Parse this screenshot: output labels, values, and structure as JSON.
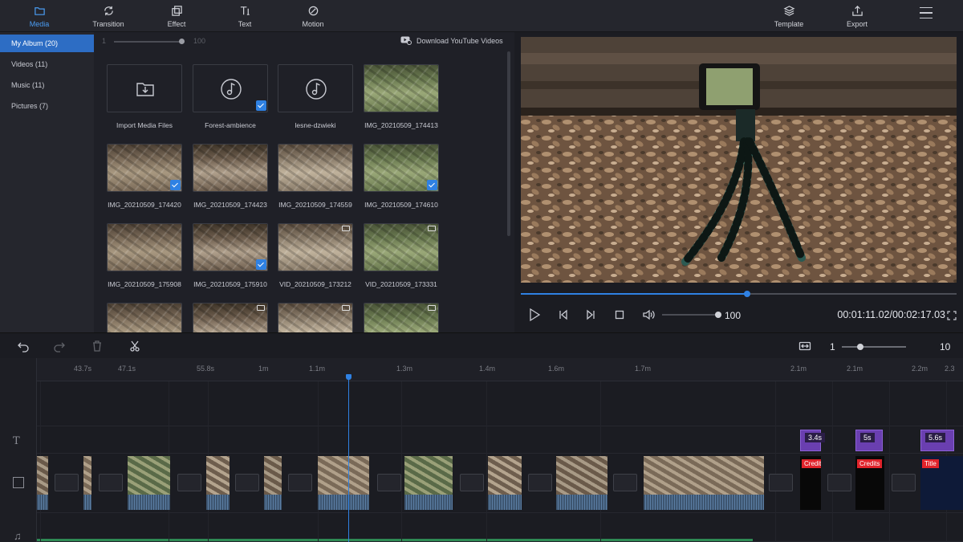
{
  "toolbar": {
    "tabs": [
      {
        "label": "Media",
        "icon": "folder-icon"
      },
      {
        "label": "Transition",
        "icon": "transition-icon"
      },
      {
        "label": "Effect",
        "icon": "effect-icon"
      },
      {
        "label": "Text",
        "icon": "text-icon"
      },
      {
        "label": "Motion",
        "icon": "motion-icon"
      }
    ],
    "template_label": "Template",
    "export_label": "Export"
  },
  "sidebar": {
    "items": [
      {
        "label": "My Album",
        "count": "(20)"
      },
      {
        "label": "Videos",
        "count": "(11)"
      },
      {
        "label": "Music",
        "count": "(11)"
      },
      {
        "label": "Pictures",
        "count": "(7)"
      }
    ]
  },
  "media": {
    "zoom_min": "1",
    "zoom_max": "100",
    "download_label": "Download YouTube Videos",
    "tiles": [
      {
        "label": "Import Media Files",
        "kind": "import",
        "checked": false
      },
      {
        "label": "Forest-ambience",
        "kind": "audio",
        "checked": true
      },
      {
        "label": "lesne-dzwieki",
        "kind": "audio",
        "checked": false
      },
      {
        "label": "IMG_20210509_174413",
        "kind": "photo",
        "checked": false
      },
      {
        "label": "IMG_20210509_174420",
        "kind": "photo",
        "checked": true
      },
      {
        "label": "IMG_20210509_174423",
        "kind": "photo",
        "checked": false
      },
      {
        "label": "IMG_20210509_174559",
        "kind": "photo",
        "checked": false
      },
      {
        "label": "IMG_20210509_174610",
        "kind": "photo",
        "checked": true
      },
      {
        "label": "IMG_20210509_175908",
        "kind": "photo",
        "checked": false
      },
      {
        "label": "IMG_20210509_175910",
        "kind": "photo",
        "checked": true
      },
      {
        "label": "VID_20210509_173212",
        "kind": "video",
        "checked": false
      },
      {
        "label": "VID_20210509_173331",
        "kind": "video",
        "checked": false
      },
      {
        "label": "",
        "kind": "photo",
        "checked": false
      },
      {
        "label": "",
        "kind": "video",
        "checked": false
      },
      {
        "label": "",
        "kind": "video",
        "checked": false
      },
      {
        "label": "",
        "kind": "video",
        "checked": false
      }
    ]
  },
  "player": {
    "volume": "100",
    "progress": 0.52,
    "current_time": "00:01:11.02",
    "total_time": "00:02:17.03",
    "timecode": "00:01:11.02/00:02:17.03"
  },
  "timeline": {
    "zoom_value": "1",
    "zoom_max": "10",
    "ruler_ticks": [
      "43.7s",
      "47.1s",
      "55.8s",
      "1m",
      "1.1m",
      "1.3m",
      "1.4m",
      "1.6m",
      "1.7m",
      "2.1m",
      "2.1m",
      "2.2m",
      "2.3"
    ],
    "text_clips": [
      "3.4s",
      "5s",
      "5.6s"
    ],
    "credit_tags": [
      "Credits",
      "Credits",
      "Title"
    ]
  },
  "colors": {
    "accent": "#2f81e3",
    "panel": "#25262d",
    "background": "#1b1c22",
    "text_clip": "#6a3fb0"
  }
}
